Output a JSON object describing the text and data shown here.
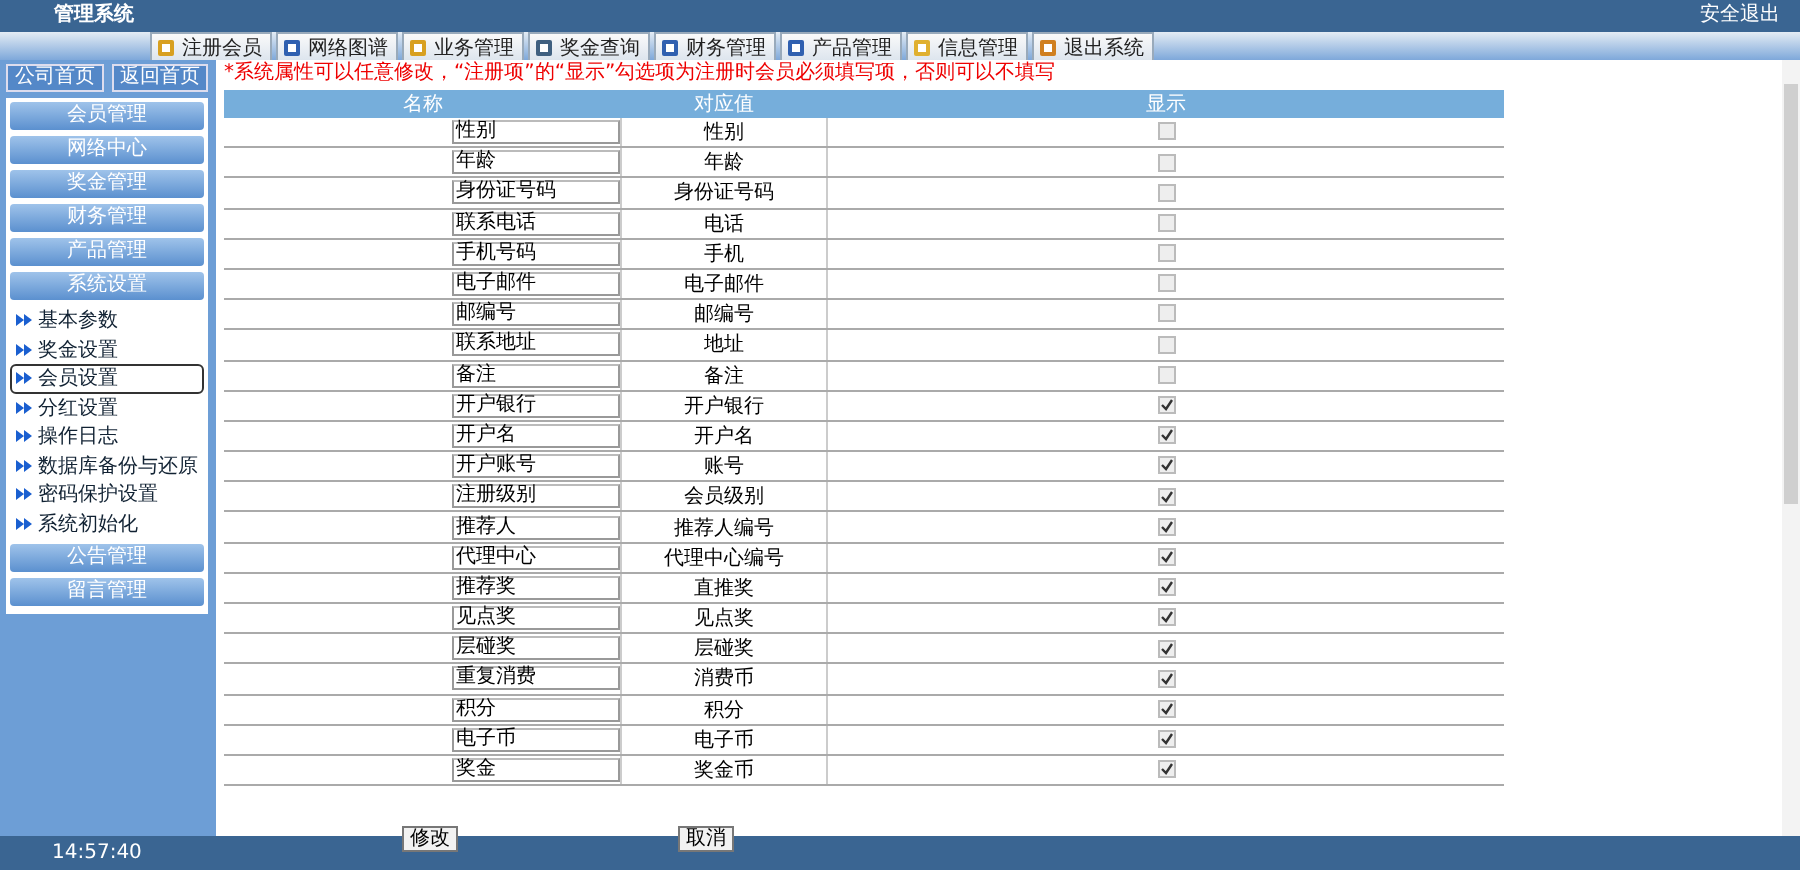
{
  "window": {
    "title": "管理系统",
    "logout": "安全退出"
  },
  "tabs": [
    {
      "label": "注册会员",
      "selected": false
    },
    {
      "label": "网络图谱",
      "selected": false
    },
    {
      "label": "业务管理",
      "selected": false
    },
    {
      "label": "奖金查询",
      "selected": false
    },
    {
      "label": "财务管理",
      "selected": false
    },
    {
      "label": "产品管理",
      "selected": false
    },
    {
      "label": "信息管理",
      "selected": false
    },
    {
      "label": "退出系统",
      "selected": false
    }
  ],
  "sidebar": {
    "top_buttons": [
      "公司首页",
      "返回首页"
    ],
    "items": [
      {
        "label": "会员管理"
      },
      {
        "label": "网络中心"
      },
      {
        "label": "奖金管理"
      },
      {
        "label": "财务管理"
      },
      {
        "label": "产品管理"
      },
      {
        "label": "系统设置",
        "children": [
          {
            "label": "基本参数",
            "selected": false
          },
          {
            "label": "奖金设置",
            "selected": false
          },
          {
            "label": "会员设置",
            "selected": true
          },
          {
            "label": "分红设置",
            "selected": false
          },
          {
            "label": "操作日志",
            "selected": false
          },
          {
            "label": "数据库备份与还原",
            "selected": false
          },
          {
            "label": "密码保护设置",
            "selected": false
          },
          {
            "label": "系统初始化",
            "selected": false
          }
        ]
      },
      {
        "label": "公告管理"
      },
      {
        "label": "留言管理"
      }
    ]
  },
  "notice": "*系统属性可以任意修改，“注册项”的“显示”勾选项为注册时会员必须填写项，否则可以不填写",
  "table": {
    "columns": [
      "名称",
      "对应值",
      "显示"
    ],
    "rows": [
      {
        "name": "性别",
        "value": "性别",
        "checked": false
      },
      {
        "name": "年龄",
        "value": "年龄",
        "checked": false
      },
      {
        "name": "身份证号码",
        "value": "身份证号码",
        "checked": false
      },
      {
        "name": "联系电话",
        "value": "电话",
        "checked": false
      },
      {
        "name": "手机号码",
        "value": "手机",
        "checked": false
      },
      {
        "name": "电子邮件",
        "value": "电子邮件",
        "checked": false
      },
      {
        "name": "邮编号",
        "value": "邮编号",
        "checked": false
      },
      {
        "name": "联系地址",
        "value": "地址",
        "checked": false
      },
      {
        "name": "备注",
        "value": "备注",
        "checked": false
      },
      {
        "name": "开户银行",
        "value": "开户银行",
        "checked": true
      },
      {
        "name": "开户名",
        "value": "开户名",
        "checked": true
      },
      {
        "name": "开户账号",
        "value": "账号",
        "checked": true
      },
      {
        "name": "注册级别",
        "value": "会员级别",
        "checked": true
      },
      {
        "name": "推荐人",
        "value": "推荐人编号",
        "checked": true
      },
      {
        "name": "代理中心",
        "value": "代理中心编号",
        "checked": true
      },
      {
        "name": "推荐奖",
        "value": "直推奖",
        "checked": true
      },
      {
        "name": "见点奖",
        "value": "见点奖",
        "checked": true
      },
      {
        "name": "层碰奖",
        "value": "层碰奖",
        "checked": true
      },
      {
        "name": "重复消费",
        "value": "消费币",
        "checked": true
      },
      {
        "name": "积分",
        "value": "积分",
        "checked": true
      },
      {
        "name": "电子币",
        "value": "电子币",
        "checked": true
      },
      {
        "name": "奖金",
        "value": "奖金币",
        "checked": true
      }
    ]
  },
  "buttons": [
    "修改",
    "取消"
  ],
  "status_bar": {
    "time": "14:57:40"
  }
}
